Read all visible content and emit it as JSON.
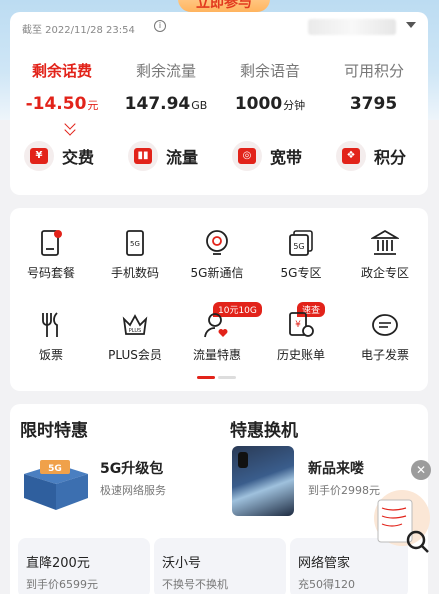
{
  "top_banner": {
    "join_label": "立即参与"
  },
  "balance": {
    "as_of": "截至 2022/11/28 23:54",
    "metrics": [
      {
        "label": "剩余话费",
        "value": "-14.50",
        "unit": "元"
      },
      {
        "label": "剩余流量",
        "value": "147.94",
        "unit": "GB"
      },
      {
        "label": "剩余语音",
        "value": "1000",
        "unit": "分钟"
      },
      {
        "label": "可用积分",
        "value": "3795",
        "unit": ""
      }
    ],
    "quick_actions": [
      {
        "label": "交费",
        "icon": "payment-icon",
        "glyph": "¥"
      },
      {
        "label": "流量",
        "icon": "data-usage-icon",
        "glyph": "▮▮"
      },
      {
        "label": "宽带",
        "icon": "broadband-icon",
        "glyph": "◎"
      },
      {
        "label": "积分",
        "icon": "points-icon",
        "glyph": "❖"
      }
    ]
  },
  "services": {
    "items": [
      {
        "label": "号码套餐",
        "icon": "sim-plan-icon"
      },
      {
        "label": "手机数码",
        "icon": "phone-digital-icon"
      },
      {
        "label": "5G新通信",
        "icon": "bulb-icon"
      },
      {
        "label": "5G专区",
        "icon": "5g-zone-icon"
      },
      {
        "label": "政企专区",
        "icon": "government-building-icon"
      },
      {
        "label": "饭票",
        "icon": "fork-knife-icon"
      },
      {
        "label": "PLUS会员",
        "icon": "crown-icon"
      },
      {
        "label": "流量特惠",
        "icon": "user-heart-icon",
        "badge": "10元10G"
      },
      {
        "label": "历史账单",
        "icon": "bill-icon",
        "badge": "速查"
      },
      {
        "label": "电子发票",
        "icon": "invoice-icon"
      }
    ]
  },
  "promo": {
    "limited_title": "限时特惠",
    "exchange_title": "特惠换机",
    "upgrade": {
      "title": "5G升级包",
      "subtitle": "极速网络服务"
    },
    "new_phone": {
      "title": "新品来喽",
      "subtitle": "到手价2998元"
    },
    "mini_cards": [
      {
        "title": "直降200元",
        "subtitle": "到手价6599元"
      },
      {
        "title": "沃小号",
        "subtitle": "不换号不换机"
      },
      {
        "title": "网络管家",
        "subtitle": "充50得120"
      }
    ]
  },
  "colors": {
    "accent": "#e2231a",
    "background": "#f2f2f4"
  }
}
